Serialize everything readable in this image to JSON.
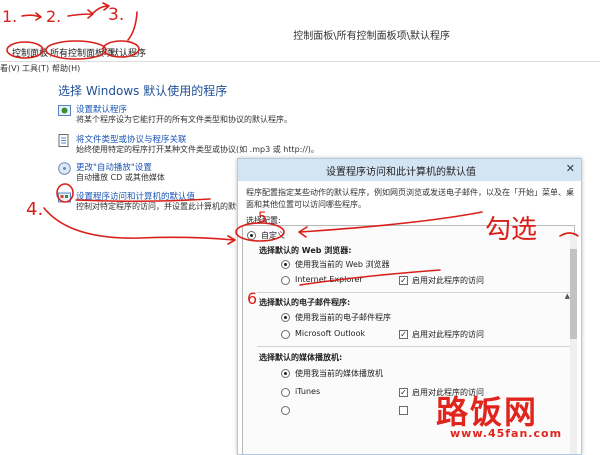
{
  "window": {
    "title": "控制面板\\所有控制面板项\\默认程序"
  },
  "breadcrumb": {
    "items": [
      "控制面板",
      "所有控制面板项",
      "默认程序"
    ],
    "separator": "›"
  },
  "menubar": {
    "items": [
      "看(V)",
      "工具(T)",
      "帮助(H)"
    ]
  },
  "main": {
    "heading": "选择 Windows 默认使用的程序",
    "tasks": [
      {
        "link": "设置默认程序",
        "desc": "将某个程序设为它能打开的所有文件类型和协议的默认程序。",
        "icon": "default-programs-icon"
      },
      {
        "link": "将文件类型或协议与程序关联",
        "desc": "始终使用特定的程序打开某种文件类型或协议(如 .mp3 或 http://)。",
        "icon": "file-association-icon"
      },
      {
        "link": "更改\"自动播放\"设置",
        "desc": "自动播放 CD 或其他媒体",
        "icon": "autoplay-icon"
      },
      {
        "link": "设置程序访问和计算机的默认值",
        "desc": "控制对特定程序的访问，并设置此计算机的默认值。",
        "icon": "program-access-icon"
      }
    ]
  },
  "dialog": {
    "title": "设置程序访问和此计算机的默认值",
    "close_glyph": "✕",
    "intro": "程序配置指定某些动作的默认程序，例如网页浏览或发送电子邮件，以及在「开始」菜单、桌面和其他位置可以访问哪些程序。",
    "choose_label": "选择配置:",
    "custom_option": {
      "label": "自定义",
      "selected": true
    },
    "sections": [
      {
        "title": "选择默认的 Web 浏览器:",
        "current_option": "使用我当前的 Web 浏览器",
        "program": "Internet Explorer",
        "enable_label": "启用对此程序的访问",
        "enable_checked": true
      },
      {
        "title": "选择默认的电子邮件程序:",
        "current_option": "使用我当前的电子邮件程序",
        "program": "Microsoft Outlook",
        "enable_label": "启用对此程序的访问",
        "enable_checked": true
      },
      {
        "title": "选择默认的媒体播放机:",
        "current_option": "使用我当前的媒体播放机",
        "program": "iTunes",
        "enable_label": "启用对此程序的访问",
        "enable_checked": true
      }
    ]
  },
  "annotations": {
    "color": "#d9201a",
    "marks": [
      "1.",
      "2.",
      "3.",
      "4.",
      "5",
      "6",
      "勾选"
    ]
  },
  "watermark": {
    "name": "路饭网",
    "url": "www.45fan.com",
    "color": "#e1241c"
  }
}
